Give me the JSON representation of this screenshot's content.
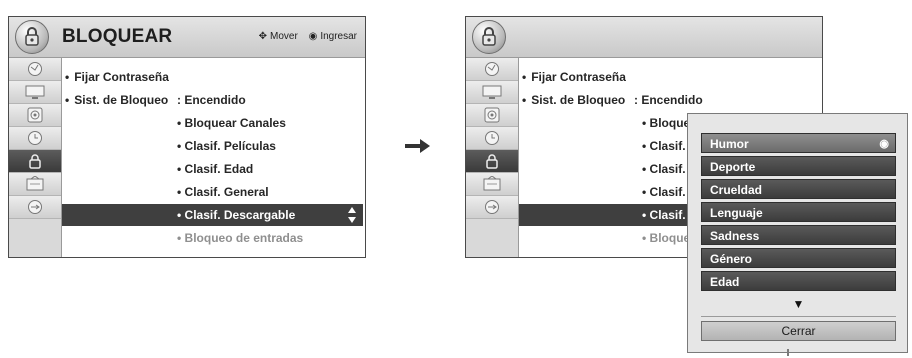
{
  "left_panel": {
    "title": "BLOQUEAR",
    "hints": [
      {
        "icon": "move-icon",
        "glyph": "✥",
        "label": "Mover"
      },
      {
        "icon": "enter-icon",
        "glyph": "◉",
        "label": "Ingresar"
      }
    ],
    "sidebar_icons": [
      "antenna-icon",
      "picture-icon",
      "audio-icon",
      "clock-icon",
      "lock-icon",
      "input-icon",
      "usb-icon"
    ],
    "menu": [
      {
        "bullet": "•",
        "label": "Fijar Contraseña"
      },
      {
        "bullet": "•",
        "label": "Sist. de Bloqueo",
        "value": ": Encendido"
      }
    ],
    "sub_items": [
      {
        "label": "• Bloquear Canales"
      },
      {
        "label": "• Clasif. Películas"
      },
      {
        "label": "• Clasif. Edad"
      },
      {
        "label": "• Clasif. General"
      },
      {
        "label": "• Clasif. Descargable",
        "selected": true
      },
      {
        "label": "• Bloqueo de entradas",
        "dimmed": true
      }
    ]
  },
  "right_panel": {
    "menu": [
      {
        "bullet": "•",
        "label": "Fijar Contraseña"
      },
      {
        "bullet": "•",
        "label": "Sist. de Bloqueo",
        "value": ": Encendido"
      }
    ],
    "sub_items": [
      {
        "label": "• Bloquear Canales"
      },
      {
        "label": "• Clasif."
      },
      {
        "label": "• Clasif."
      },
      {
        "label": "• Clasif."
      },
      {
        "label": "• Clasif.",
        "selected": true
      },
      {
        "label": "• Bloque",
        "dimmed": true
      }
    ]
  },
  "popup": {
    "options": [
      {
        "label": "Humor",
        "selected": true,
        "radio": "◉"
      },
      {
        "label": "Deporte"
      },
      {
        "label": "Crueldad"
      },
      {
        "label": "Lenguaje"
      },
      {
        "label": "Sadness"
      },
      {
        "label": "Género"
      },
      {
        "label": "Edad"
      }
    ],
    "more_arrow": "▼",
    "close_label": "Cerrar"
  },
  "colors": {
    "highlight": "#3f3f3f",
    "sidebar": "#d9d9d9",
    "header": "#d2d2d2"
  }
}
